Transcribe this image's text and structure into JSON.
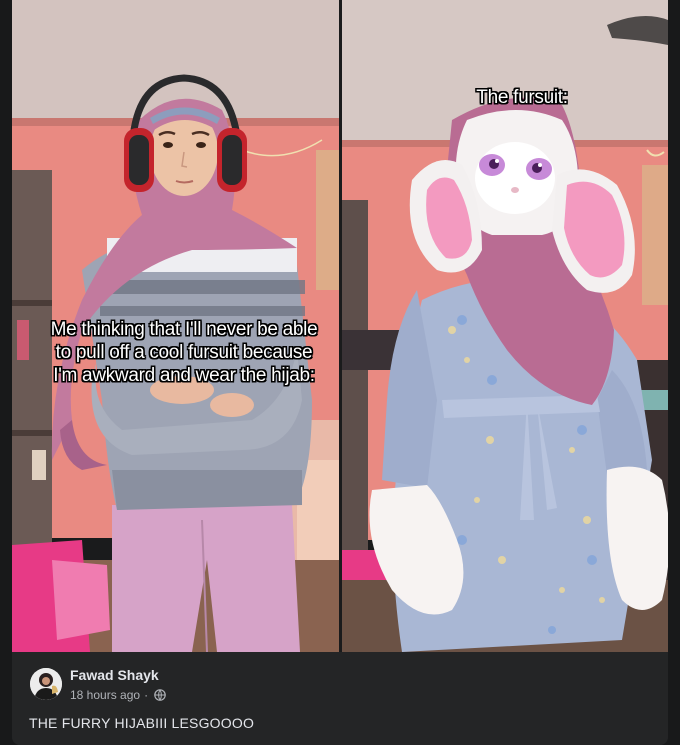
{
  "post": {
    "images": {
      "left_caption": "Me thinking that I'll never be able\nto pull off a cool fursuit because\nI'm awkward and wear the hijab:",
      "right_caption": "The fursuit:"
    },
    "author": {
      "name": "Fawad Shayk",
      "avatar_icon": "profile-avatar"
    },
    "timestamp": "18 hours ago",
    "separator": "·",
    "privacy_icon": "globe-icon",
    "text": "THE FURRY HIJABIII LESGOOOO"
  },
  "colors": {
    "page_bg": "#18191a",
    "card_bg": "#242526",
    "primary_text": "#e4e6eb",
    "secondary_text": "#b0b3b8"
  }
}
